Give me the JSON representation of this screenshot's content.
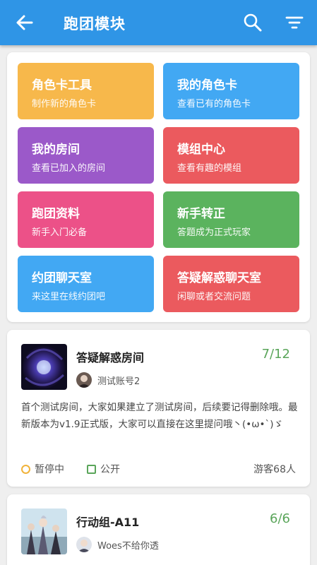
{
  "header": {
    "title": "跑团模块",
    "back_icon": "arrow-left-icon",
    "search_icon": "search-icon",
    "filter_icon": "filter-icon"
  },
  "tiles": [
    {
      "title": "角色卡工具",
      "subtitle": "制作新的角色卡",
      "color": "#f7b84b"
    },
    {
      "title": "我的角色卡",
      "subtitle": "查看已有的角色卡",
      "color": "#42a8f3"
    },
    {
      "title": "我的房间",
      "subtitle": "查看已加入的房间",
      "color": "#9b59c9"
    },
    {
      "title": "模组中心",
      "subtitle": "查看有趣的模组",
      "color": "#eb5a5e"
    },
    {
      "title": "跑团资料",
      "subtitle": "新手入门必备",
      "color": "#ec5188"
    },
    {
      "title": "新手转正",
      "subtitle": "答题成为正式玩家",
      "color": "#5bb35e"
    },
    {
      "title": "约团聊天室",
      "subtitle": "来这里在线约团吧",
      "color": "#42a8f3"
    },
    {
      "title": "答疑解惑聊天室",
      "subtitle": "闲聊或者交流问题",
      "color": "#eb5a5e"
    }
  ],
  "rooms": [
    {
      "name": "答疑解惑房间",
      "count": "7/12",
      "owner": "测试账号2",
      "description": "首个测试房间，大家如果建立了测试房间，后续要记得删除哦。最新版本为v1.9正式版，大家可以直接在这里提问哦丶(•ω•`)ゞ",
      "status": "暂停中",
      "visibility": "公开",
      "guests": "游客68人"
    },
    {
      "name": "行动组-A11",
      "count": "6/6",
      "owner": "Woes不给你透"
    }
  ]
}
